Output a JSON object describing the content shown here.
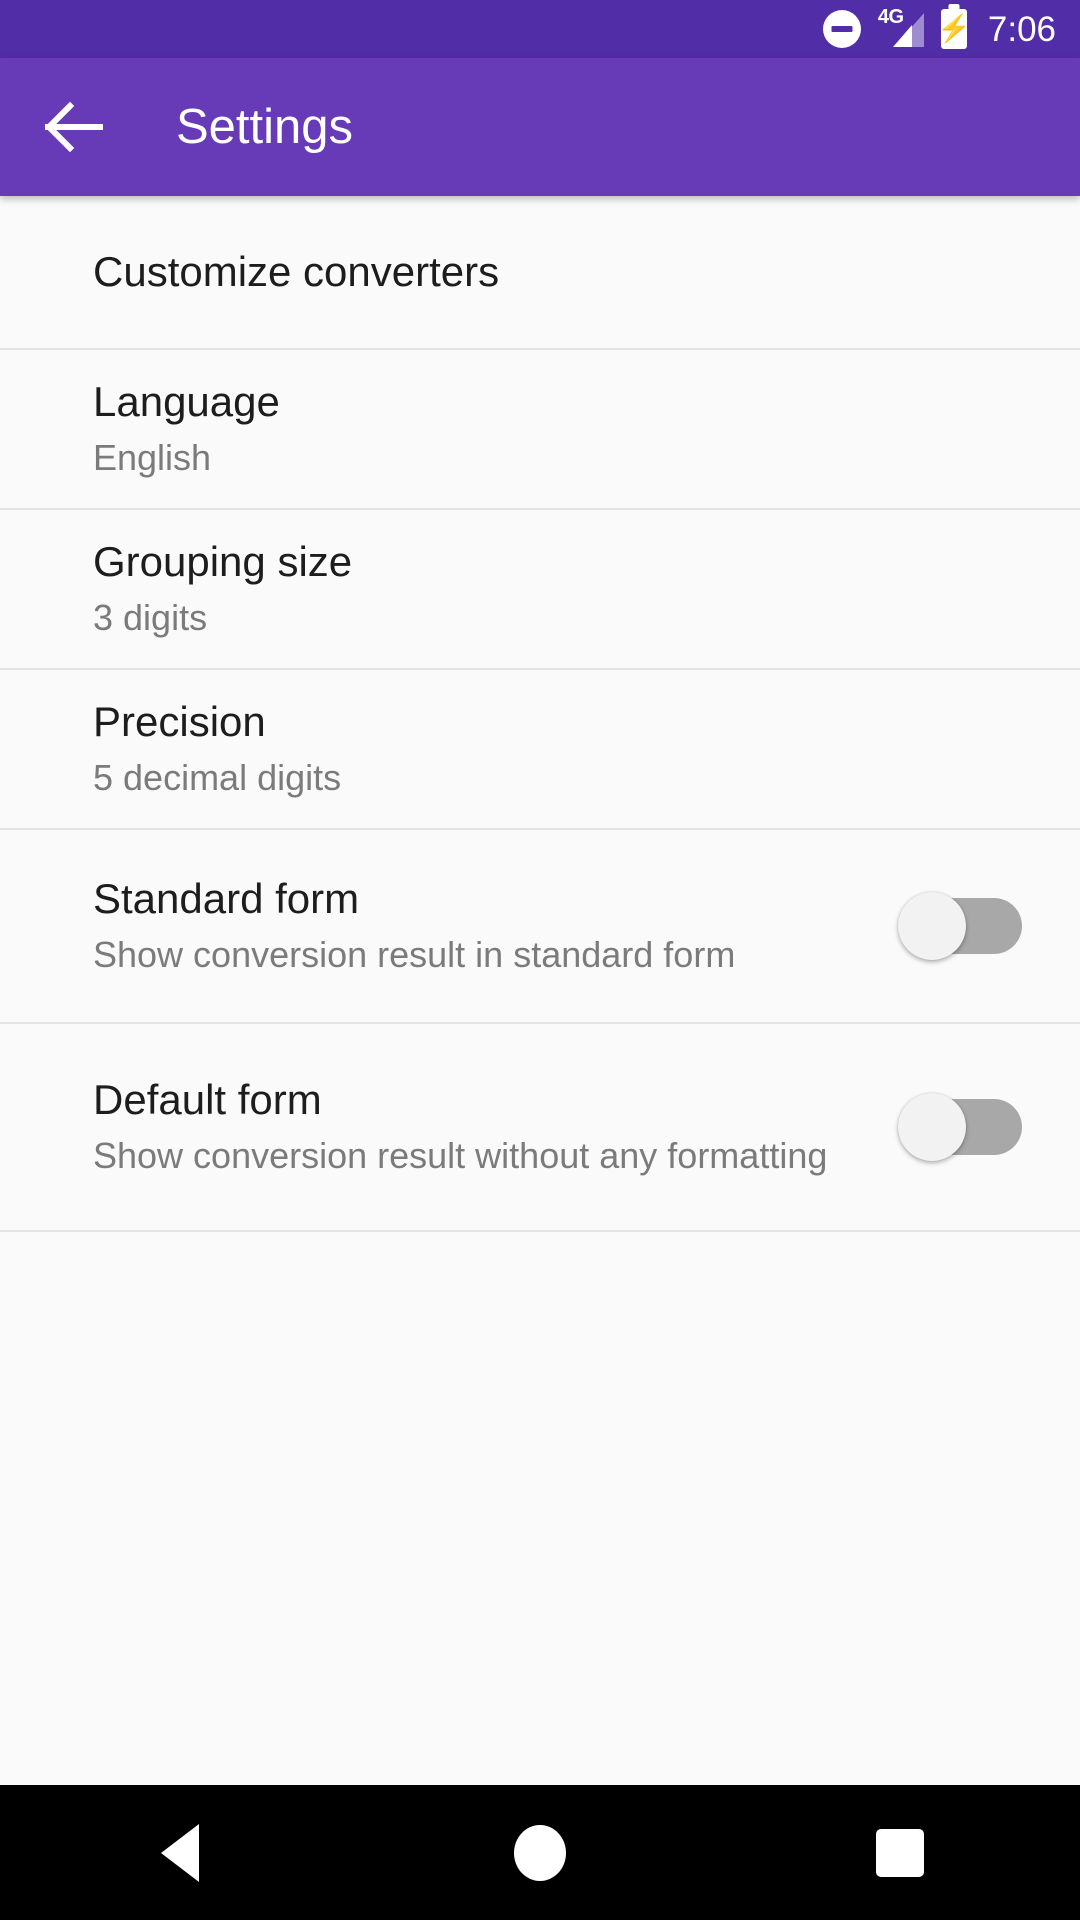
{
  "status_bar": {
    "dnd_icon": "do-not-disturb-icon",
    "network_label": "4G",
    "signal_icon": "signal-cellular-icon",
    "battery_icon": "battery-charging-icon",
    "battery_bolt": "⚡",
    "time": "7:06",
    "background_color": "#512DA8"
  },
  "app_bar": {
    "back_icon": "back-arrow-icon",
    "title": "Settings",
    "background_color": "#673AB7"
  },
  "settings": {
    "items": [
      {
        "title": "Customize converters",
        "summary": "",
        "type": "navigation"
      },
      {
        "title": "Language",
        "summary": "English",
        "type": "navigation"
      },
      {
        "title": "Grouping size",
        "summary": "3 digits",
        "type": "navigation"
      },
      {
        "title": "Precision",
        "summary": "5 decimal digits",
        "type": "navigation"
      },
      {
        "title": "Standard form",
        "summary": "Show conversion result in standard form",
        "type": "switch",
        "switch_state": "off"
      },
      {
        "title": "Default form",
        "summary": "Show conversion result without any formatting",
        "type": "switch",
        "switch_state": "off"
      }
    ]
  },
  "nav_bar": {
    "back_icon": "nav-back-triangle-icon",
    "home_icon": "nav-home-circle-icon",
    "recents_icon": "nav-recents-square-icon",
    "background_color": "#000000"
  }
}
